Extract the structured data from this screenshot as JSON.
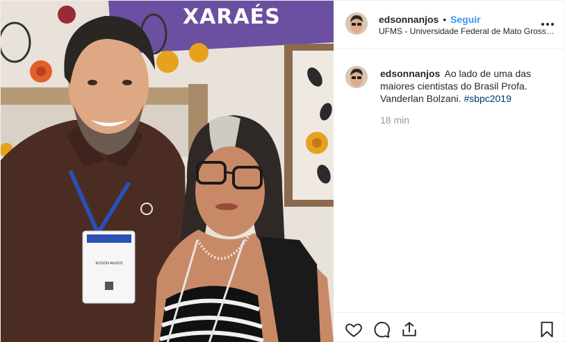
{
  "photo": {
    "banner_text": "XARAÉS",
    "badge_name": "EDSON ANJOS"
  },
  "header": {
    "username": "edsonnanjos",
    "separator": "•",
    "follow_label": "Seguir",
    "location": "UFMS - Universidade Federal de Mato Grosso do Sul",
    "more_icon": "more-options-icon"
  },
  "caption": {
    "username": "edsonnanjos",
    "text": "Ao lado de uma das maiores cientistas do Brasil Profa. Vanderlan Bolzani.",
    "hashtag": "#sbpc2019",
    "time": "18 min"
  },
  "actions": {
    "icons": [
      "heart-icon",
      "comment-icon",
      "share-icon",
      "bookmark-icon"
    ]
  },
  "colors": {
    "link": "#3897f0",
    "hashtag": "#003569",
    "banner": "#6b4fa0",
    "muted": "#999999"
  }
}
